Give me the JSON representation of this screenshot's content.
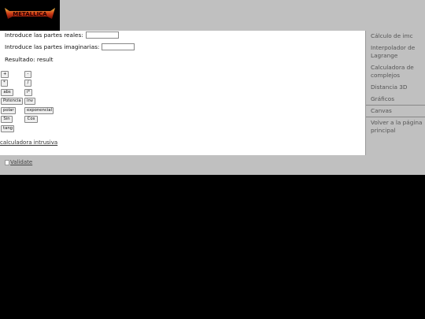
{
  "header": {
    "logo_text": "METALLICA"
  },
  "form": {
    "real_label": "Introduce las partes reales:",
    "imag_label": "Introduce las partes imaginarias:",
    "result_label": "Resultado: result"
  },
  "buttons": {
    "add": "+",
    "sub": "-",
    "mul": "*",
    "div": "/",
    "abs": "abs",
    "conj": "i*",
    "pow": "Potencia",
    "inv": "inv",
    "polar": "polar",
    "exp": "exponencial",
    "sin": "Sin",
    "cos": "Cos",
    "tan": "tang"
  },
  "links": {
    "intrusive": "calculadora intrusiva"
  },
  "sidebar": {
    "items": [
      {
        "label": "Cálculo de imc"
      },
      {
        "label": "Interpolador de Lagrange"
      },
      {
        "label": "Calculadora de complejos"
      },
      {
        "label": "Distancia 3D"
      },
      {
        "label": "Gráficos"
      },
      {
        "label": "Canvas"
      },
      {
        "label": "Volver a la página principal"
      }
    ]
  },
  "footer": {
    "validate_alt": "Validate"
  },
  "colors": {
    "header_bg": "#c0c0c0",
    "page_bg": "#000000",
    "content_bg": "#ffffff"
  }
}
